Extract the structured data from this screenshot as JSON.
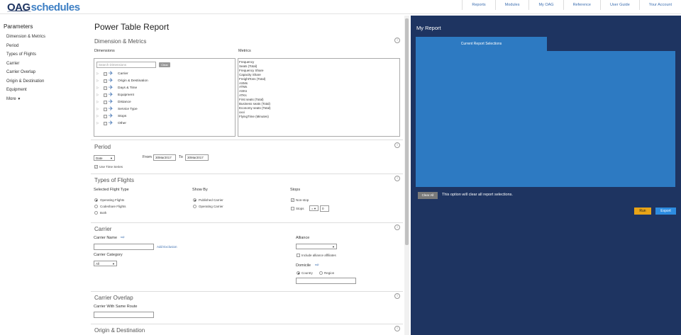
{
  "logo": {
    "part1": "OAG",
    "part2": "schedules"
  },
  "topnav": [
    "Reports",
    "Modules",
    "My OAG",
    "Reference",
    "User Guide",
    "Your Account"
  ],
  "parameters": {
    "title": "Parameters",
    "links": [
      "Dimension & Metrics",
      "Period",
      "Types of Flights",
      "Carrier",
      "Carrier Overlap",
      "Origin & Destination",
      "Equipment",
      "More"
    ]
  },
  "page_title": "Power Table Report",
  "dim_metrics": {
    "title": "Dimension & Metrics",
    "dimensions_label": "Dimensions",
    "metrics_label": "Metrics",
    "search_placeholder": "Search Dimensions",
    "clear": "Clear",
    "dimensions": [
      "Carrier",
      "Origin & Destination",
      "Days & Time",
      "Equipment",
      "Distance",
      "Service Type",
      "Stops",
      "Other"
    ],
    "metrics": [
      "Frequency",
      "Seats (Total)",
      "Frequency Share",
      "Capacity Share",
      "FreightTons (Total)",
      "ASMs",
      "ATMs",
      "ASKs",
      "ATKs",
      "First seats (Total)",
      "Business seats (Total)",
      "Economy seats (Total)",
      "xxxi",
      "FlyingTime (Minutes)"
    ]
  },
  "period": {
    "title": "Period",
    "type_value": "Date",
    "from_label": "From",
    "from_value": "30Mar2017",
    "to_label": "To",
    "to_value": "30Mar2017",
    "time_series": "Use Time Series"
  },
  "types_of_flights": {
    "title": "Types of Flights",
    "selected_label": "Selected Flight Type",
    "flight_types": [
      "Operating Flights",
      "Codeshare Flights",
      "Both"
    ],
    "show_by_label": "Show By",
    "show_by": [
      "Published Carrier",
      "Operating Carrier"
    ],
    "stops_label": "Stops",
    "nonstop": "Non-stop",
    "stops": "Stops",
    "stops_op": "=",
    "stops_value": "0"
  },
  "carrier": {
    "title": "Carrier",
    "name_label": "Carrier Name",
    "add_exclusion": "Add Exclusion",
    "category_label": "Carrier Category",
    "category_value": "All",
    "alliance_label": "Alliance",
    "include_affiliates": "Include alliance affiliates",
    "domicile_label": "Domicile",
    "country": "Country",
    "region": "Region"
  },
  "carrier_overlap": {
    "title": "Carrier Overlap",
    "same_route_label": "Carrier With Same Route"
  },
  "origin_destination": {
    "title": "Origin & Destination"
  },
  "my_report": {
    "title": "My Report",
    "tab": "Current Report Selections",
    "clear_all": "Clear All",
    "clear_text": "This option will clear all report selections.",
    "run": "Run",
    "export": "Export"
  }
}
